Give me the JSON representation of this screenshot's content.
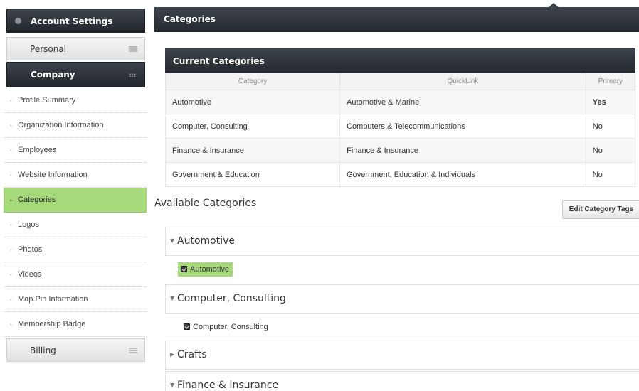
{
  "sidebar": {
    "account_settings": "Account Settings",
    "personal": "Personal",
    "company": "Company",
    "billing": "Billing",
    "items": [
      {
        "label": "Profile Summary"
      },
      {
        "label": "Organization Information"
      },
      {
        "label": "Employees"
      },
      {
        "label": "Website Information"
      },
      {
        "label": "Categories",
        "active": true
      },
      {
        "label": "Logos"
      },
      {
        "label": "Photos"
      },
      {
        "label": "Videos"
      },
      {
        "label": "Map Pin Information"
      },
      {
        "label": "Membership Badge"
      }
    ]
  },
  "page": {
    "title": "Categories"
  },
  "current": {
    "title": "Current Categories",
    "columns": [
      "Category",
      "QuickLink",
      "Primary"
    ],
    "rows": [
      {
        "category": "Automotive",
        "quicklink": "Automotive & Marine",
        "primary": "Yes"
      },
      {
        "category": "Computer, Consulting",
        "quicklink": "Computers & Telecommunications",
        "primary": "No"
      },
      {
        "category": "Finance & Insurance",
        "quicklink": "Finance & Insurance",
        "primary": "No"
      },
      {
        "category": "Government & Education",
        "quicklink": "Government, Education & Individuals",
        "primary": "No"
      }
    ]
  },
  "available": {
    "title": "Available Categories",
    "edit_button": "Edit Category Tags",
    "groups": [
      {
        "name": "Automotive",
        "expanded": true,
        "checked_item": "Automotive"
      },
      {
        "name": "Computer, Consulting",
        "expanded": true,
        "checked_item": "Computer, Consulting"
      },
      {
        "name": "Crafts",
        "expanded": false
      },
      {
        "name": "Finance & Insurance",
        "expanded": true
      }
    ]
  },
  "colors": {
    "active": "#a5d97a",
    "dark_header": "#2f343b"
  }
}
